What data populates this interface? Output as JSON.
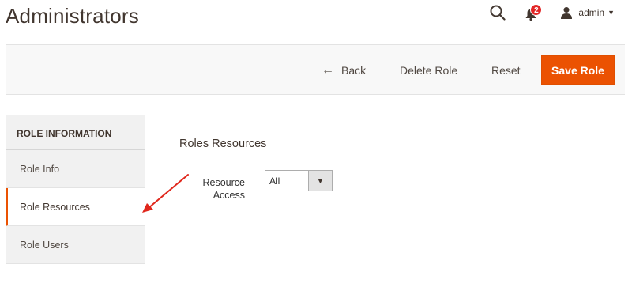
{
  "header": {
    "title": "Administrators",
    "notification_count": "2",
    "user_name": "admin",
    "icons": [
      "search-icon",
      "bell-icon",
      "user-icon",
      "chevron-down-icon"
    ]
  },
  "toolbar": {
    "back_label": "Back",
    "delete_label": "Delete Role",
    "reset_label": "Reset",
    "save_label": "Save Role"
  },
  "sidebar": {
    "heading": "ROLE INFORMATION",
    "items": [
      {
        "label": "Role Info",
        "active": false
      },
      {
        "label": "Role Resources",
        "active": true
      },
      {
        "label": "Role Users",
        "active": false
      }
    ]
  },
  "main": {
    "section_title": "Roles Resources",
    "resource_access": {
      "label": "Resource Access",
      "value": "All"
    }
  },
  "colors": {
    "accent": "#eb5202",
    "badge": "#e22626",
    "annotation_arrow": "#e0271c"
  }
}
